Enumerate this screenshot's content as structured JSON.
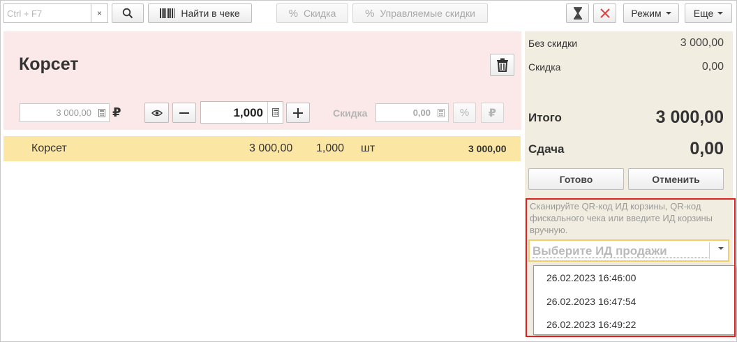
{
  "toolbar": {
    "search_placeholder": "Ctrl + F7",
    "clear_glyph": "×",
    "find_in_receipt": "Найти в чеке",
    "discount": "Скидка",
    "managed_discounts": "Управляемые скидки",
    "mode": "Режим",
    "more": "Еще"
  },
  "product": {
    "title": "Корсет",
    "price": "3 000,00",
    "currency": "₽",
    "quantity": "1,000",
    "discount_label": "Скидка",
    "discount_value": "0,00"
  },
  "line_items": [
    {
      "name": "Корсет",
      "price": "3 000,00",
      "quantity": "1,000",
      "unit": "шт",
      "total": "3 000,00"
    }
  ],
  "totals": {
    "no_discount_label": "Без скидки",
    "no_discount_value": "3 000,00",
    "discount_label": "Скидка",
    "discount_value": "0,00",
    "total_label": "Итого",
    "total_value": "3 000,00",
    "change_label": "Сдача",
    "change_value": "0,00"
  },
  "actions": {
    "done": "Готово",
    "cancel": "Отменить"
  },
  "sale_id": {
    "hint": "Сканируйте QR-код ИД корзины, QR-код фискального чека или введите ИД корзины вручную.",
    "placeholder": "Выберите ИД продажи",
    "options": [
      "26.02.2023 16:46:00",
      "26.02.2023 16:47:54",
      "26.02.2023 16:49:22"
    ]
  },
  "colors": {
    "header_bg": "#fbe9e9",
    "selected_row": "#fbe6a3",
    "right_pane_bg": "#f1ede0",
    "highlight_frame": "#e02020"
  }
}
